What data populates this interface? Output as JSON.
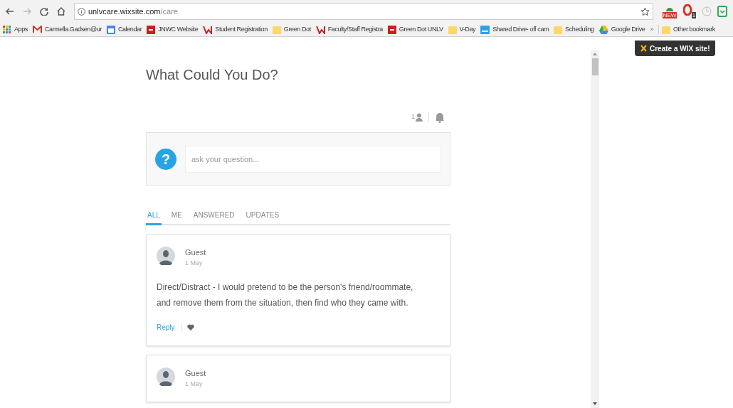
{
  "browser": {
    "url_host": "unlvcare.wixsite.com",
    "url_path": "/care",
    "bookmarks": [
      {
        "kind": "apps",
        "label": "Apps"
      },
      {
        "kind": "mail",
        "label": "Carmella.Gadsen@ur"
      },
      {
        "kind": "calendar",
        "label": "Calendar"
      },
      {
        "kind": "red",
        "label": "JNWC Website"
      },
      {
        "kind": "unlv",
        "label": "Student Registration"
      },
      {
        "kind": "folder",
        "label": "Green Dot"
      },
      {
        "kind": "unlv",
        "label": "Faculty/Staff Registra"
      },
      {
        "kind": "red",
        "label": "Green Dot UNLV"
      },
      {
        "kind": "folder",
        "label": "V-Day"
      },
      {
        "kind": "shared",
        "label": "Shared Drive- off cam"
      },
      {
        "kind": "folder",
        "label": "Scheduling"
      },
      {
        "kind": "drive",
        "label": "Google Drive"
      }
    ],
    "overflow": "»",
    "other_bookmarks": "Other bookmark",
    "extension_badges": [
      "NEW",
      "1"
    ]
  },
  "wix_banner": "Create a WIX site!",
  "page": {
    "title": "What Could You Do?",
    "follower_count": "1",
    "ask_placeholder": "ask your question...",
    "ask_icon": "?",
    "tabs": [
      {
        "label": "ALL",
        "selected": true
      },
      {
        "label": "ME",
        "selected": false
      },
      {
        "label": "ANSWERED",
        "selected": false
      },
      {
        "label": "UPDATES",
        "selected": false
      }
    ],
    "posts": [
      {
        "author": "Guest",
        "date": "1 May",
        "body": "Direct/Distract - I would pretend to be the person's friend/roommate, and remove them from the situation, then find who they came with.",
        "reply": "Reply"
      },
      {
        "author": "Guest",
        "date": "1 May"
      }
    ]
  }
}
